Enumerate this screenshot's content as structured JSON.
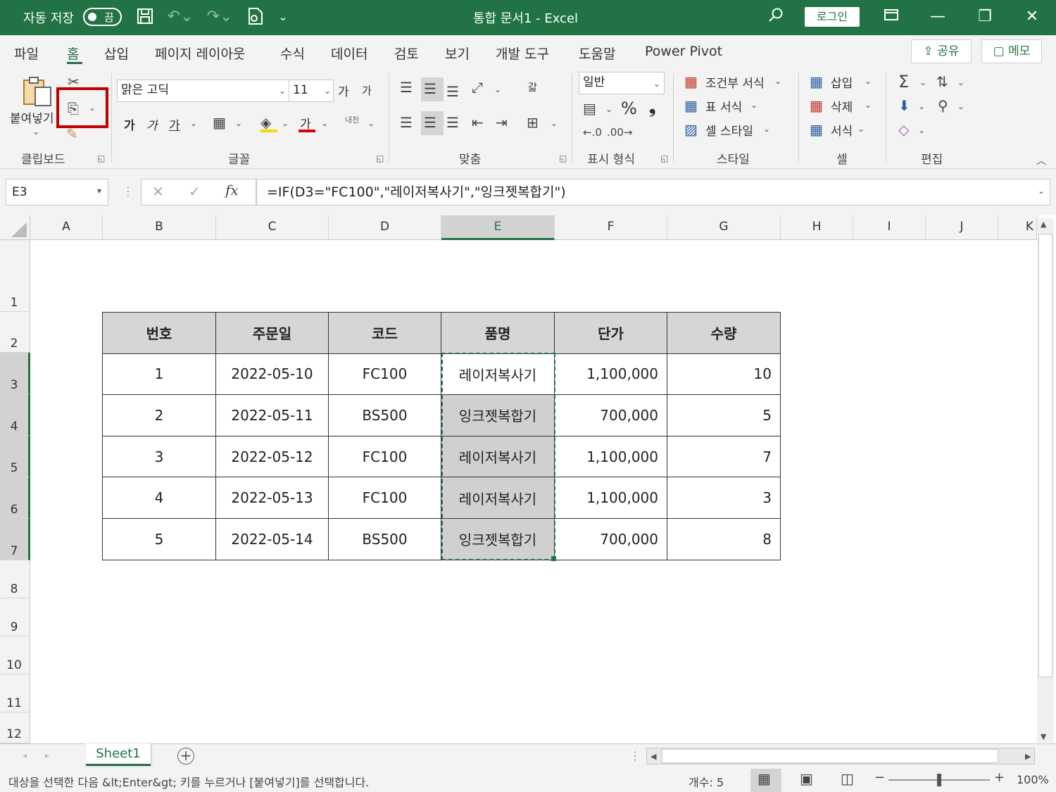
{
  "titlebar": {
    "autosave_label": "자동 저장",
    "autosave_state": "끔",
    "doc_title": "통합 문서1  -  Excel",
    "login_label": "로그인",
    "icons": [
      "save-icon",
      "undo-icon",
      "redo-icon",
      "print-preview-icon",
      "customize-icon",
      "search-icon",
      "ribbon-display-icon",
      "minimize-icon",
      "restore-icon",
      "close-icon"
    ]
  },
  "menu": {
    "tabs": [
      "파일",
      "홈",
      "삽입",
      "페이지 레이아웃",
      "수식",
      "데이터",
      "검토",
      "보기",
      "개발 도구",
      "도움말",
      "Power Pivot"
    ],
    "active": "홈",
    "share_label": "공유",
    "memo_label": "메모"
  },
  "ribbon": {
    "clipboard": {
      "paste_label": "붙여넣기",
      "group_label": "클립보드"
    },
    "font": {
      "font_name": "맑은 고딕",
      "font_size": "11",
      "grow": "가",
      "shrink": "가",
      "bold": "가",
      "italic": "가",
      "underline": "가",
      "font_color_glyph": "가",
      "phonetic": "내천",
      "group_label": "글꼴"
    },
    "alignment": {
      "wrap_label": "갋",
      "group_label": "맞춤"
    },
    "number": {
      "format": "일반",
      "percent": "%",
      "comma": "❟",
      "group_label": "표시 형식"
    },
    "styles": {
      "conditional": "조건부 서식",
      "table_format": "표 서식",
      "cell_styles": "셀 스타일",
      "group_label": "스타일"
    },
    "cells": {
      "insert": "삽입",
      "delete": "삭제",
      "format": "서식",
      "group_label": "셀"
    },
    "editing": {
      "group_label": "편집"
    }
  },
  "formula_bar": {
    "name_box": "E3",
    "fx": "fx",
    "formula": "=IF(D3=\"FC100\",\"레이저복사기\",\"잉크젯복합기\")"
  },
  "columns": [
    "A",
    "B",
    "C",
    "D",
    "E",
    "F",
    "G",
    "H",
    "I",
    "J",
    "K"
  ],
  "rows": [
    "1",
    "2",
    "3",
    "4",
    "5",
    "6",
    "7",
    "8",
    "9",
    "10",
    "11",
    "12"
  ],
  "selected_column": "E",
  "table": {
    "headers": [
      "번호",
      "주문일",
      "코드",
      "품명",
      "단가",
      "수량"
    ],
    "rows": [
      [
        "1",
        "2022-05-10",
        "FC100",
        "레이저복사기",
        "1,100,000",
        "10"
      ],
      [
        "2",
        "2022-05-11",
        "BS500",
        "잉크젯복합기",
        "700,000",
        "5"
      ],
      [
        "3",
        "2022-05-12",
        "FC100",
        "레이저복사기",
        "1,100,000",
        "7"
      ],
      [
        "4",
        "2022-05-13",
        "FC100",
        "레이저복사기",
        "1,100,000",
        "3"
      ],
      [
        "5",
        "2022-05-14",
        "BS500",
        "잉크젯복합기",
        "700,000",
        "8"
      ]
    ]
  },
  "sheet_tabs": [
    "Sheet1"
  ],
  "status": {
    "message": "대상을 선택한 다음 &lt;Enter&gt; 키를 누르거나 [붙여넣기]를 선택합니다.",
    "count": "개수: 5",
    "zoom": "100%"
  },
  "colors": {
    "accent": "#217346",
    "highlight_box": "#c00000",
    "selected_cell_fill": "#d0d0d0"
  }
}
